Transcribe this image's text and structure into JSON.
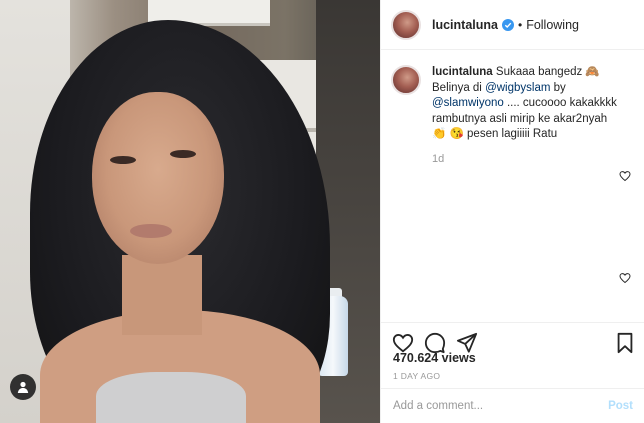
{
  "post": {
    "username": "lucintaluna",
    "follow_status": "Following",
    "separator": "•",
    "caption": {
      "username": "lucintaluna",
      "text_1": "Sukaaa bangedz 🙈",
      "text_2": "Belinya di ",
      "mention_1": "@wigbyslam",
      "text_3": " by ",
      "mention_2": "@slamwiyono",
      "text_4": " .... cucoooo kakakkkk rambutnya asli mirip ke akar2nyah 👏 😘 pesen lagiiiii Ratu"
    },
    "timestamp": "1d",
    "views": "470.624 views",
    "posted_ago": "1 DAY AGO",
    "comment_placeholder": "Add a comment...",
    "post_label": "Post"
  },
  "icons": {
    "like": "heart-icon",
    "comment": "comment-icon",
    "share": "share-icon",
    "save": "bookmark-icon",
    "verified": "verified-badge-icon",
    "tagged": "user-tag-icon"
  },
  "colors": {
    "verified_blue": "#3897f0",
    "mention": "#003569",
    "muted": "#999999",
    "post_disabled": "#b2dffc"
  }
}
